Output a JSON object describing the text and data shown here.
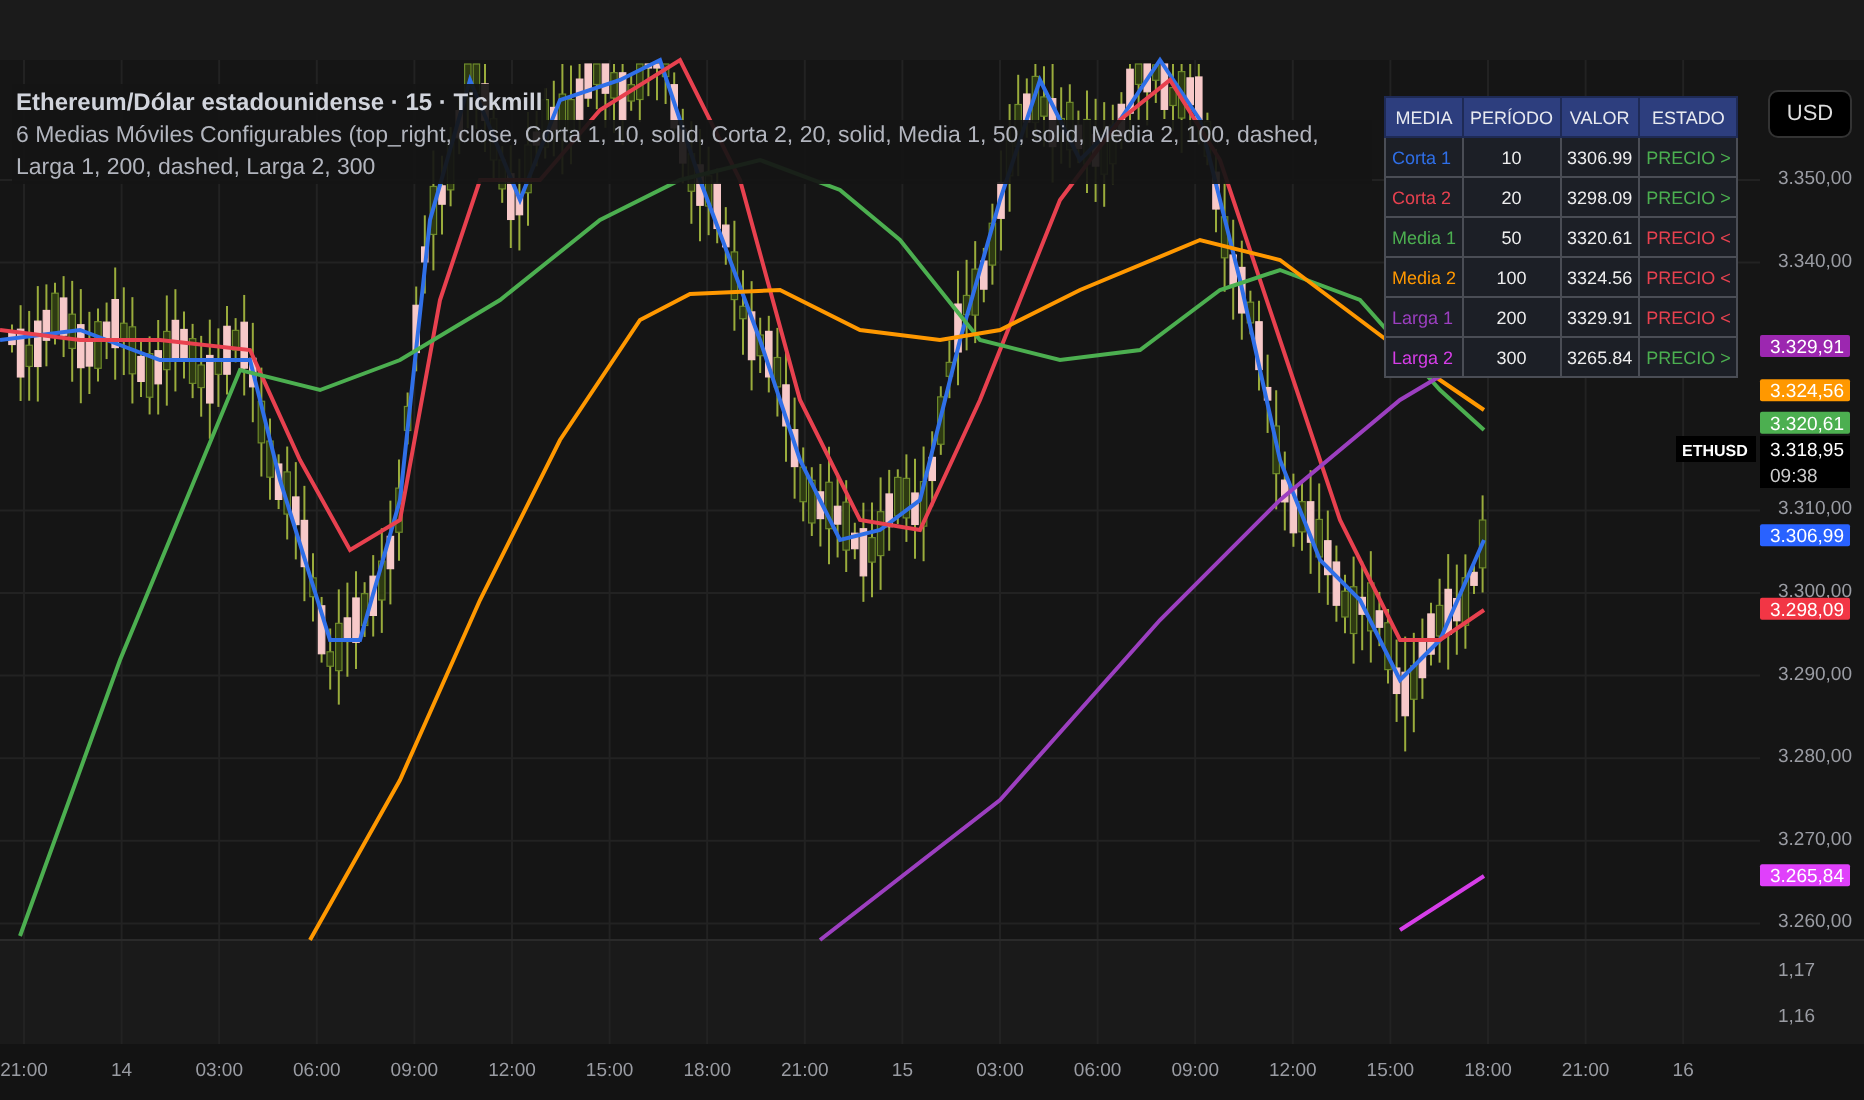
{
  "header": {
    "title": "Ethereum/Dólar estadounidense · 15 · Tickmill",
    "indicator": "6 Medias Móviles Configurables (top_right, close, Corta 1, 10, solid, Corta 2, 20, solid, Media 1, 50, solid, Media 2, 100, dashed, Larga 1, 200, dashed, Larga 2, 300"
  },
  "currency_button": "USD",
  "ma_table": {
    "columns": [
      "MEDIA",
      "PERÍODO",
      "VALOR",
      "ESTADO"
    ],
    "rows": [
      {
        "name": "Corta 1",
        "color": "#2f6fe8",
        "period": "10",
        "value": "3306.99",
        "state": "PRECIO >",
        "above": true
      },
      {
        "name": "Corta 2",
        "color": "#e8414f",
        "period": "20",
        "value": "3298.09",
        "state": "PRECIO >",
        "above": true
      },
      {
        "name": "Media 1",
        "color": "#4caf50",
        "period": "50",
        "value": "3320.61",
        "state": "PRECIO <",
        "above": false
      },
      {
        "name": "Media 2",
        "color": "#ff9800",
        "period": "100",
        "value": "3324.56",
        "state": "PRECIO <",
        "above": false
      },
      {
        "name": "Larga 1",
        "color": "#9c3fc0",
        "period": "200",
        "value": "3329.91",
        "state": "PRECIO <",
        "above": false
      },
      {
        "name": "Larga 2",
        "color": "#d63ee8",
        "period": "300",
        "value": "3265.84",
        "state": "PRECIO >",
        "above": true
      }
    ]
  },
  "price_axis": {
    "ticks": [
      "3.350,00",
      "3.340,00",
      "3.310,00",
      "3.300,00",
      "3.290,00",
      "3.280,00",
      "3.270,00",
      "3.260,00"
    ],
    "markers": [
      {
        "label": "3.329,91",
        "color": "#9c27b0"
      },
      {
        "label": "3.324,56",
        "color": "#ff9800"
      },
      {
        "label": "3.320,61",
        "color": "#4caf50"
      },
      {
        "label": "3.306,99",
        "color": "#2962ff"
      },
      {
        "label": "3.298,09",
        "color": "#f23645"
      },
      {
        "label": "3.265,84",
        "color": "#e040fb"
      }
    ],
    "last_price": {
      "symbol": "ETHUSD",
      "price": "3.318,95",
      "countdown": "09:38"
    }
  },
  "lower_pane_axis": [
    "1,17",
    "1,16"
  ],
  "time_axis": [
    "21:00",
    "14",
    "03:00",
    "06:00",
    "09:00",
    "12:00",
    "15:00",
    "18:00",
    "21:00",
    "15",
    "03:00",
    "06:00",
    "09:00",
    "12:00",
    "15:00",
    "18:00",
    "21:00",
    "16"
  ]
}
